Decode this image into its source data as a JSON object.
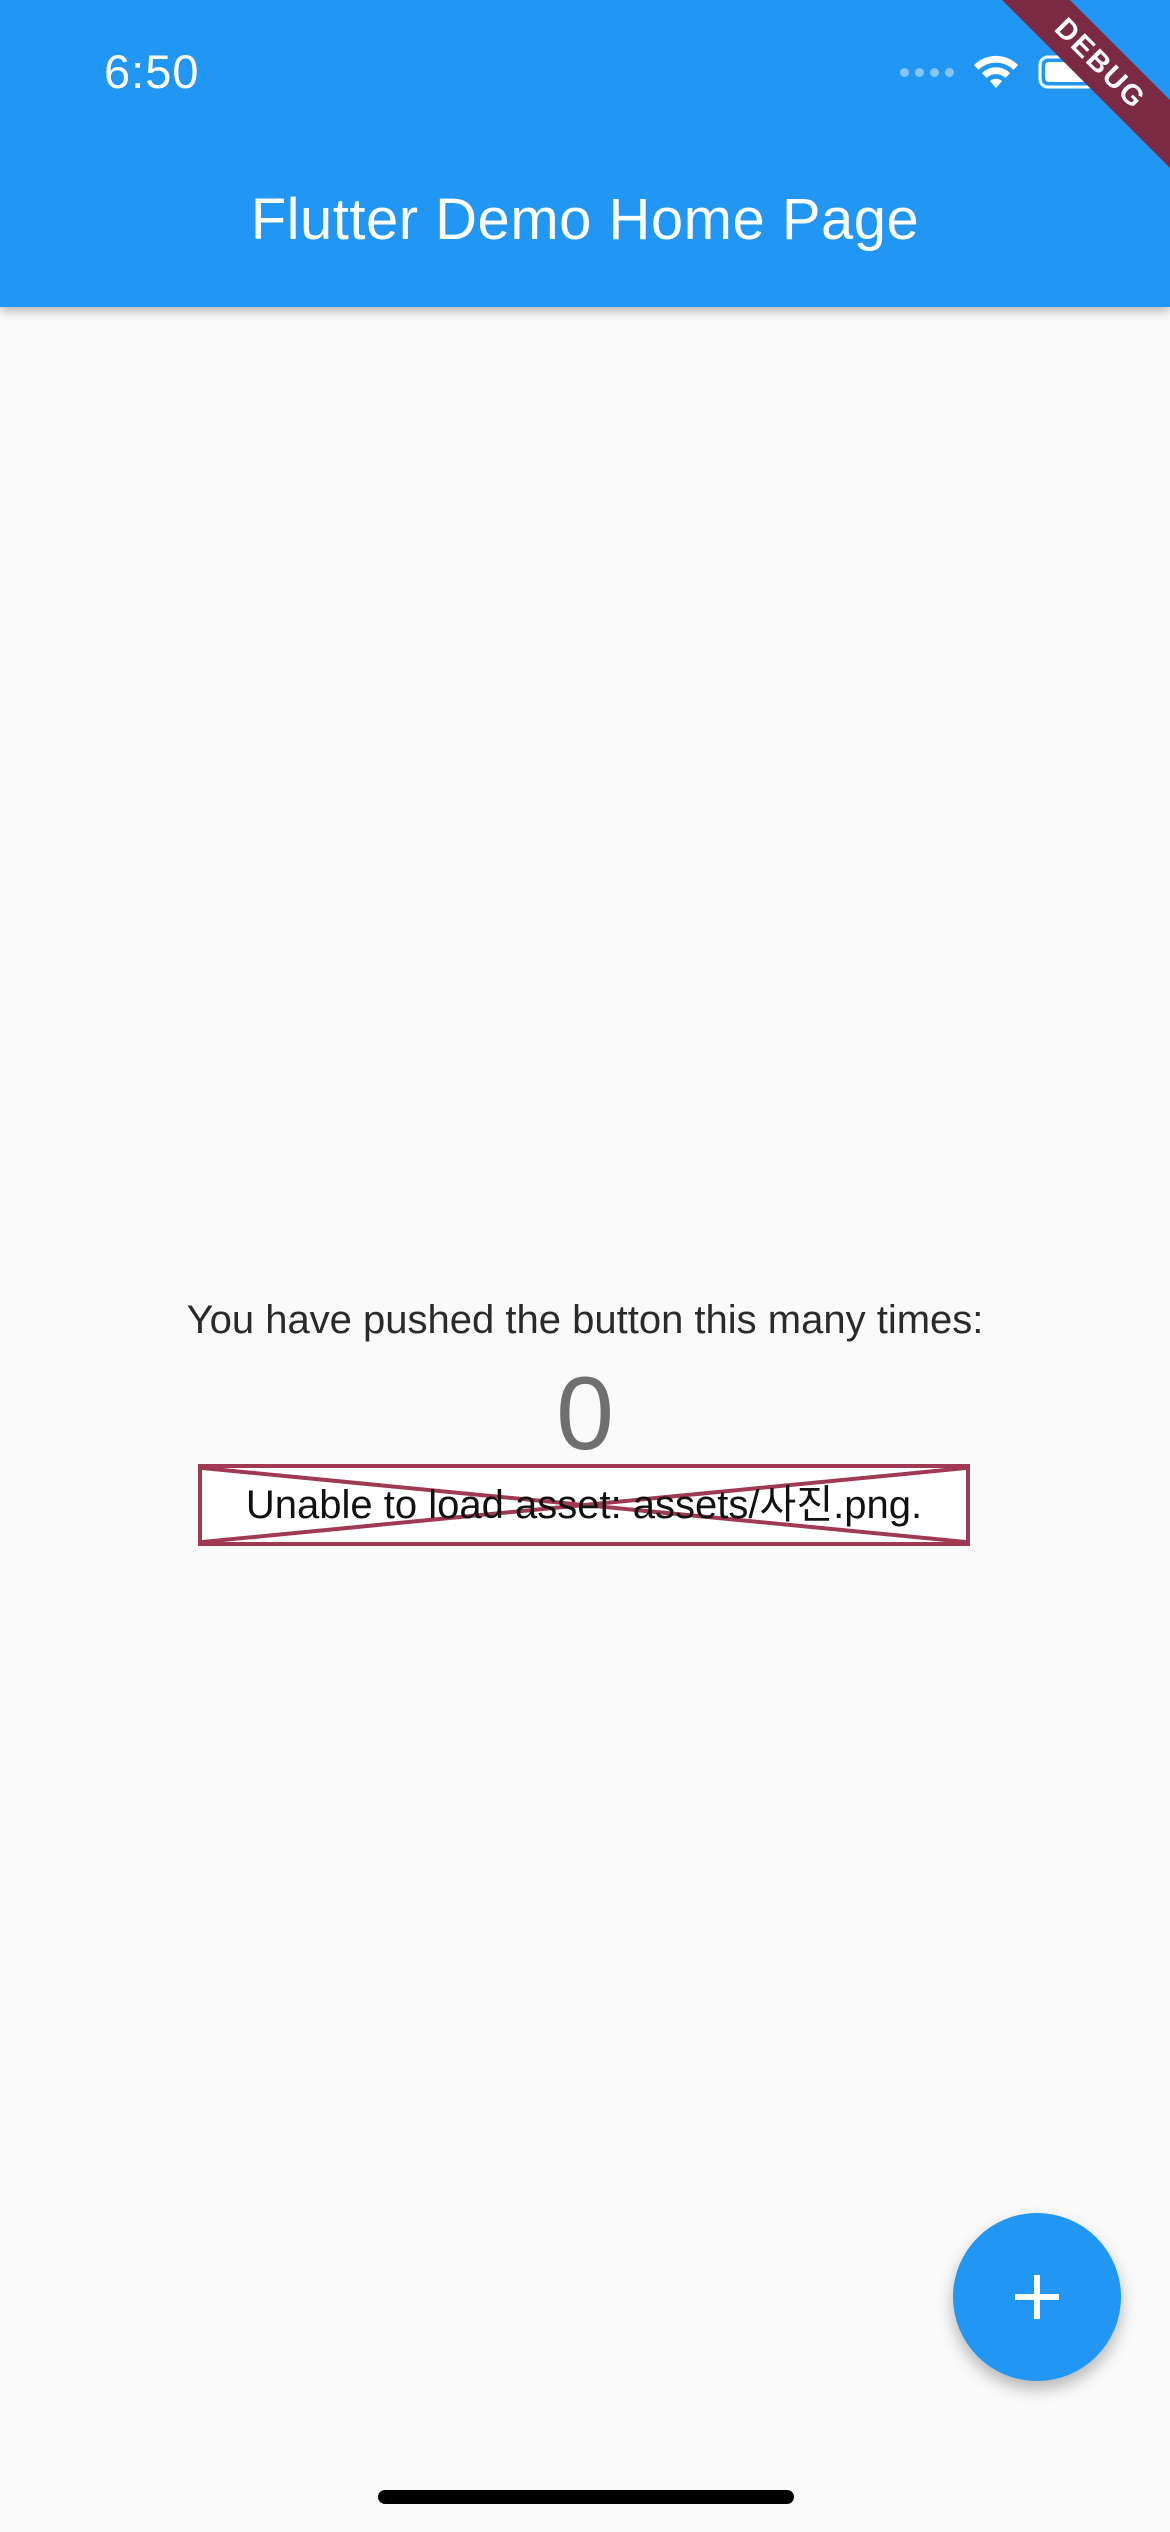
{
  "status_bar": {
    "time": "6:50"
  },
  "app_bar": {
    "title": "Flutter Demo Home Page",
    "color": "#2196f3"
  },
  "debug_banner": {
    "label": "DEBUG",
    "color": "#7a2a43"
  },
  "counter": {
    "label": "You have pushed the button this many times:",
    "value": "0"
  },
  "image_error": {
    "message": "Unable to load asset: assets/사진.png.",
    "border_color": "#a03a52"
  },
  "fab": {
    "icon": "plus-icon",
    "color": "#2196f3"
  },
  "icons": {
    "wifi": "wifi-icon",
    "battery": "battery-icon",
    "signal": "signal-icon"
  }
}
